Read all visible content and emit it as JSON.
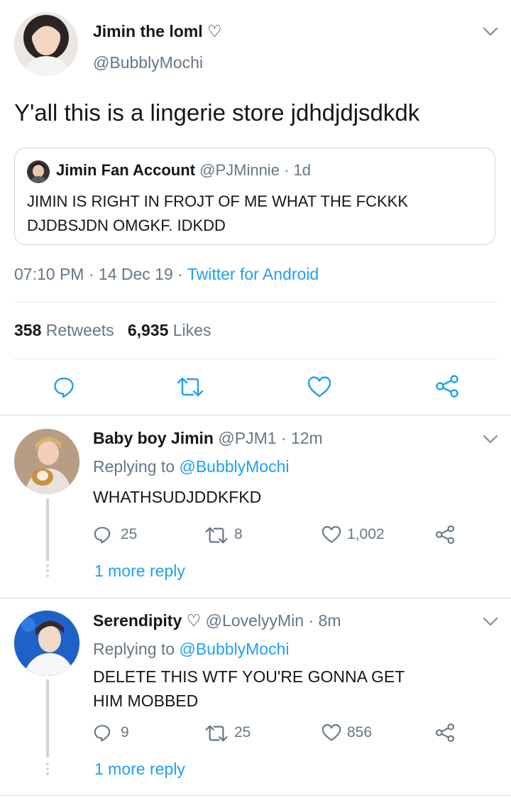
{
  "main_tweet": {
    "display_name": "Jimin the loml",
    "heart_symbol": "♡",
    "handle": "@BubblyMochi",
    "text": "Y'all this is a lingerie store jdhdjdjsdkdk",
    "quoted": {
      "display_name": "Jimin Fan Account",
      "handle": "@PJMinnie",
      "dot": "·",
      "age": "1d",
      "text_line1": "JIMIN IS RIGHT IN FROJT OF ME WHAT THE FCKKK",
      "text_line2": "DJDBSJDN OMGKF. IDKDD"
    },
    "time": "07:10 PM",
    "sep1": "·",
    "date": "14 Dec 19",
    "sep2": "·",
    "client": "Twitter for Android",
    "retweets_count": "358",
    "retweets_label": "Retweets",
    "likes_count": "6,935",
    "likes_label": "Likes"
  },
  "replies": [
    {
      "display_name": "Baby boy Jimin",
      "handle": "@PJM1",
      "dot": "·",
      "age": "12m",
      "replying_prefix": "Replying to",
      "replying_to": "@BubblyMochi",
      "text_line1": "WHATHSUDJDDKFKD",
      "text_line2": "",
      "reply_count": "25",
      "retweet_count": "8",
      "like_count": "1,002",
      "more_replies": "1 more reply"
    },
    {
      "display_name": "Serendipity",
      "heart_symbol": "♡",
      "handle": "@LovelyyMin",
      "dot": "·",
      "age": "8m",
      "replying_prefix": "Replying to",
      "replying_to": "@BubblyMochi",
      "text_line1": "DELETE THIS WTF YOU'RE GONNA GET",
      "text_line2": "HIM MOBBED",
      "reply_count": "9",
      "retweet_count": "25",
      "like_count": "856",
      "more_replies": "1 more reply"
    }
  ],
  "colors": {
    "accent": "#1da1f2",
    "secondary_text": "#657786",
    "divider": "#e1e8ed",
    "icon": "#1da1f2"
  },
  "icons": [
    "chevron-down-icon",
    "reply-icon",
    "retweet-icon",
    "like-icon",
    "share-icon",
    "thread-dots-icon"
  ]
}
